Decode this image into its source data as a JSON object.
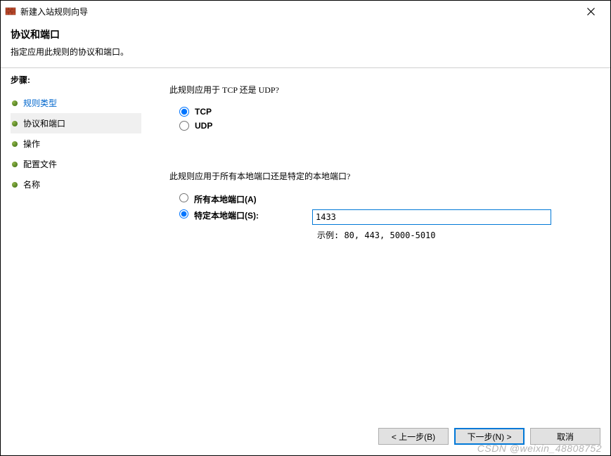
{
  "window": {
    "title": "新建入站规则向导"
  },
  "header": {
    "title": "协议和端口",
    "description": "指定应用此规则的协议和端口。"
  },
  "sidebar": {
    "steps_label": "步骤:",
    "items": [
      {
        "label": "规则类型"
      },
      {
        "label": "协议和端口"
      },
      {
        "label": "操作"
      },
      {
        "label": "配置文件"
      },
      {
        "label": "名称"
      }
    ]
  },
  "content": {
    "protocol_question": "此规则应用于 TCP 还是 UDP?",
    "protocol_tcp": "TCP",
    "protocol_udp": "UDP",
    "port_question": "此规则应用于所有本地端口还是特定的本地端口?",
    "port_all": "所有本地端口(A)",
    "port_specific": "特定本地端口(S):",
    "port_value": "1433",
    "port_example": "示例: 80, 443, 5000-5010"
  },
  "footer": {
    "back": "< 上一步(B)",
    "next": "下一步(N) >",
    "cancel": "取消"
  },
  "watermark": "CSDN @weixin_48808752"
}
